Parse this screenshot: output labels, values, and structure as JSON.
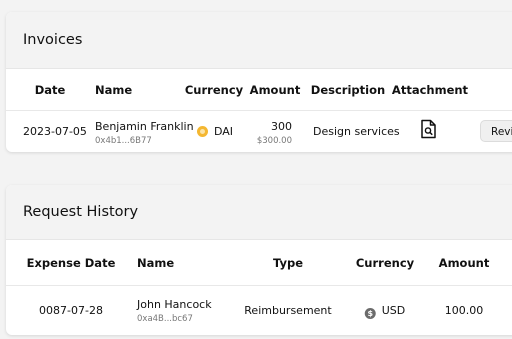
{
  "invoices": {
    "title": "Invoices",
    "columns": [
      "Date",
      "Name",
      "Currency",
      "Amount",
      "Description",
      "Attachment"
    ],
    "rows": [
      {
        "date": "2023-07-05",
        "name": "Benjamin Franklin",
        "address": "0x4b1...6B77",
        "currency": "DAI",
        "currency_icon": "dai-coin-icon",
        "amount": "300",
        "amount_fiat": "$300.00",
        "description": "Design services",
        "attachment_icon": "file-search-icon",
        "action_label": "Review"
      }
    ]
  },
  "request_history": {
    "title": "Request History",
    "columns": [
      "Expense Date",
      "Name",
      "Type",
      "Currency",
      "Amount"
    ],
    "rows": [
      {
        "date": "0087-07-28",
        "name": "John Hancock",
        "address": "0xa4B...bc67",
        "type": "Reimbursement",
        "currency": "USD",
        "currency_icon": "usd-coin-icon",
        "amount": "100.00"
      }
    ]
  },
  "colors": {
    "background": "#f3f3f3",
    "card": "#ffffff",
    "dai": "#f4b731",
    "usd": "#6b6b6b"
  }
}
